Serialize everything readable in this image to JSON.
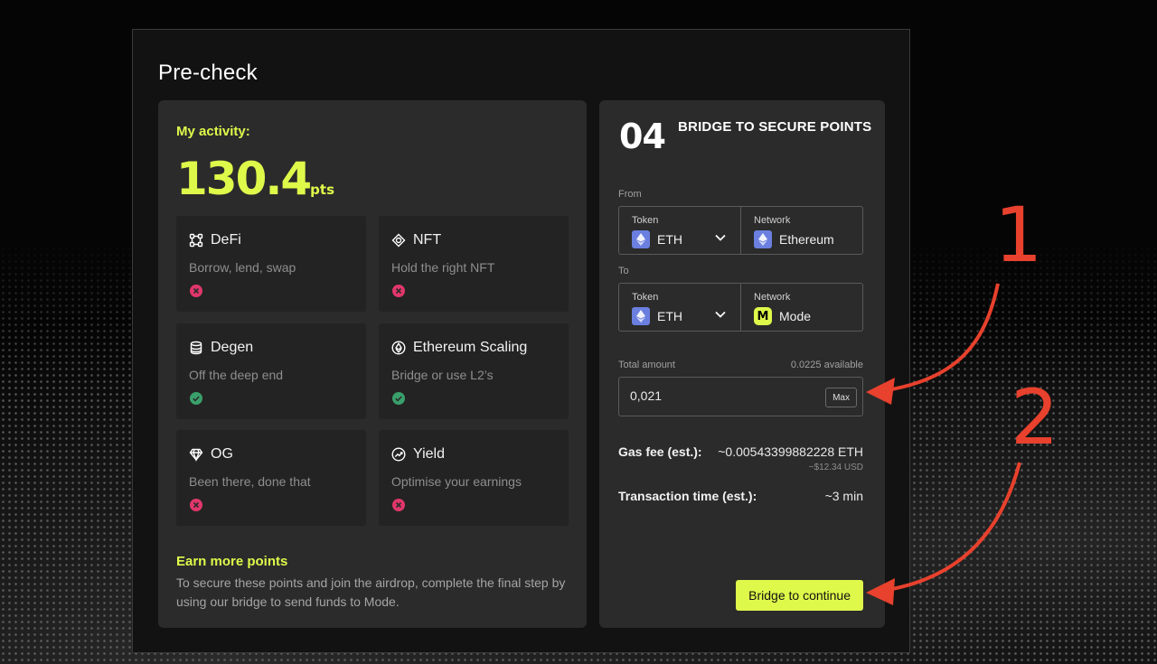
{
  "modal": {
    "title": "Pre-check"
  },
  "activity": {
    "label": "My activity:",
    "score": "130.4",
    "unit": "pts"
  },
  "cards": [
    {
      "title": "DeFi",
      "desc": "Borrow, lend, swap",
      "status": "fail",
      "icon": "defi-icon"
    },
    {
      "title": "NFT",
      "desc": "Hold the right NFT",
      "status": "fail",
      "icon": "nft-icon"
    },
    {
      "title": "Degen",
      "desc": "Off the deep end",
      "status": "pass",
      "icon": "coins-icon"
    },
    {
      "title": "Ethereum Scaling",
      "desc": "Bridge or use L2’s",
      "status": "pass",
      "icon": "ethereum-icon"
    },
    {
      "title": "OG",
      "desc": "Been there, done that",
      "status": "fail",
      "icon": "diamond-icon"
    },
    {
      "title": "Yield",
      "desc": "Optimise your earnings",
      "status": "fail",
      "icon": "yield-icon"
    }
  ],
  "earn": {
    "title": "Earn more points",
    "text": "To secure these points and join the airdrop, complete the final step by using our bridge to send funds to Mode."
  },
  "bridge": {
    "step_number": "04",
    "step_title": "BRIDGE TO SECURE POINTS",
    "from_label": "From",
    "to_label": "To",
    "from": {
      "token_label": "Token",
      "token": "ETH",
      "network_label": "Network",
      "network": "Ethereum"
    },
    "to": {
      "token_label": "Token",
      "token": "ETH",
      "network_label": "Network",
      "network": "Mode",
      "network_badge": "M"
    },
    "amount_label": "Total amount",
    "available": "0.0225 available",
    "amount_value": "0,021",
    "max_label": "Max",
    "gas_label": "Gas fee (est.):",
    "gas_value": "~0.00543399882228 ETH",
    "gas_usd": "~$12.34 USD",
    "time_label": "Transaction time (est.):",
    "time_value": "~3 min",
    "button_label": "Bridge to continue"
  },
  "annotations": {
    "one": "1",
    "two": "2"
  },
  "colors": {
    "accent": "#dff94a",
    "fail": "#e0376b",
    "pass": "#3aa06b",
    "annotation": "#e8412d",
    "eth": "#6b7fe0"
  }
}
